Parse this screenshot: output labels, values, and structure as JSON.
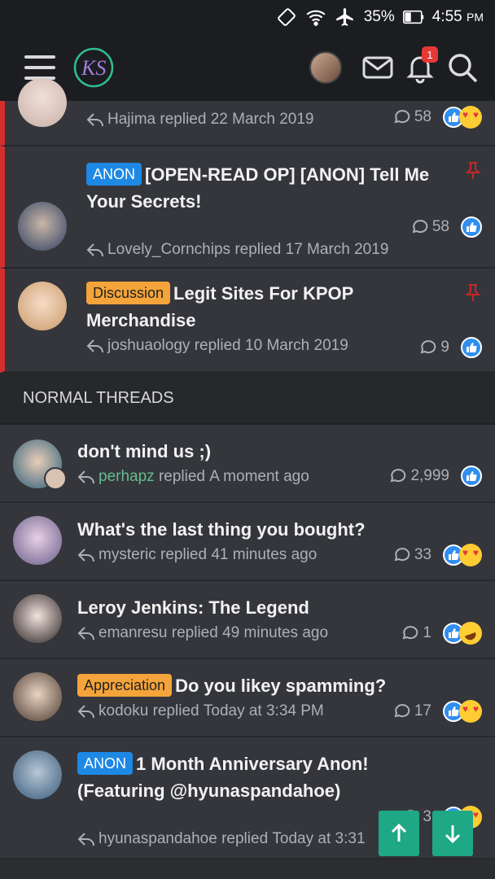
{
  "status": {
    "battery": "35%",
    "time": "4:55",
    "ampm": "PM"
  },
  "header": {
    "logo_text": "KS",
    "notification_count": "1"
  },
  "threads_top": [
    {
      "user": "Hajima",
      "action": "replied",
      "when": "22 March 2019",
      "replies": "58",
      "reactions": [
        "like",
        "love"
      ]
    },
    {
      "prefix": "ANON",
      "title": "[OPEN-READ OP] [ANON] Tell Me Your Secrets!",
      "user": "Lovely_Cornchips",
      "action": "replied",
      "when": "17 March 2019",
      "replies": "58",
      "reactions": [
        "like"
      ]
    },
    {
      "prefix": "Discussion",
      "title": "Legit Sites For KPOP Merchandise",
      "user": "joshuaology",
      "action": "replied",
      "when": "10 March 2019",
      "replies": "9",
      "reactions": [
        "like"
      ]
    }
  ],
  "section_title": "NORMAL THREADS",
  "threads": [
    {
      "title": "don't mind us ;)",
      "user": "perhapz",
      "action": "replied",
      "when": "A moment ago",
      "replies": "2,999"
    },
    {
      "title": "What's the last thing you bought?",
      "user": "mysteric",
      "action": "replied",
      "when": "41 minutes ago",
      "replies": "33"
    },
    {
      "title": "Leroy Jenkins: The Legend",
      "user": "emanresu",
      "action": "replied",
      "when": "49 minutes ago",
      "replies": "1"
    },
    {
      "prefix": "Appreciation",
      "title": "Do you likey spamming?",
      "user": "kodoku",
      "action": "replied",
      "when": "Today at 3:34 PM",
      "replies": "17"
    },
    {
      "prefix": "ANON",
      "title": "1 Month Anniversary Anon! (Featuring @hyunaspandahoe)",
      "user": "hyunaspandahoe",
      "action": "replied",
      "when": "Today at 3:31",
      "replies": "3"
    }
  ],
  "colors": {
    "accent_green": "#1ea885",
    "sticky_red": "#d32f2f",
    "anon_blue": "#1e88e5",
    "prefix_orange": "#f4a43a",
    "like_blue": "#2f8ef0"
  }
}
